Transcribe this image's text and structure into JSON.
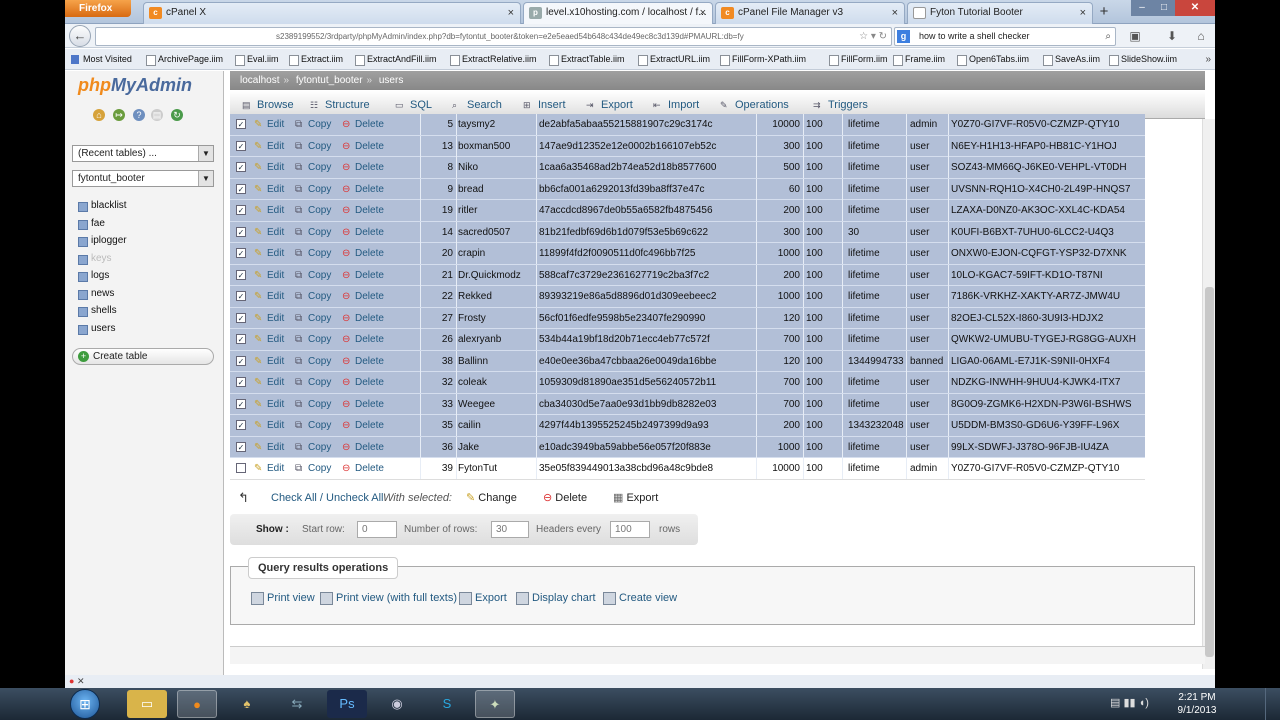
{
  "browser": {
    "app_button": "Firefox",
    "tabs": [
      {
        "title": "cPanel X",
        "icon": "cpanel-icon"
      },
      {
        "title": "level.x10hosting.com / localhost / f...",
        "icon": "pma-icon"
      },
      {
        "title": "cPanel File Manager v3",
        "icon": "cpanel-icon"
      },
      {
        "title": "Fyton Tutorial Booter",
        "icon": "page-icon"
      }
    ],
    "new_tab": "+",
    "url": "s2389199552/3rdparty/phpMyAdmin/index.php?db=fytontut_booter&token=e2e5eaed54b648c434de49ec8c3d139d#PMAURL:db=fy",
    "search_text": "how to write a shell checker",
    "bookmarks": [
      "Most Visited",
      "ArchivePage.iim",
      "Eval.iim",
      "Extract.iim",
      "ExtractAndFill.iim",
      "ExtractRelative.iim",
      "ExtractTable.iim",
      "ExtractURL.iim",
      "FillForm-XPath.iim",
      "FillForm.iim",
      "Frame.iim",
      "Open6Tabs.iim",
      "SaveAs.iim",
      "SlideShow.iim"
    ],
    "more": "»"
  },
  "pma": {
    "logo_php": "php",
    "logo_rest": "MyAdmin",
    "recent_tables": "(Recent tables) ...",
    "db_select": "fytontut_booter",
    "tables": [
      "blacklist",
      "fae",
      "iplogger",
      "keys",
      "logs",
      "news",
      "shells",
      "users"
    ],
    "create_table": "Create table",
    "breadcrumb": [
      "localhost",
      "fytontut_booter",
      "users"
    ],
    "menu": [
      "Browse",
      "Structure",
      "SQL",
      "Search",
      "Insert",
      "Export",
      "Import",
      "Operations",
      "Triggers"
    ],
    "actions": {
      "edit": "Edit",
      "copy": "Copy",
      "delete": "Delete"
    },
    "rows": [
      {
        "id": "5",
        "user": "taysmy2",
        "hash": "de2abfa5abaa55215881907c29c3174c",
        "c1": "10000",
        "c2": "100",
        "exp": "lifetime",
        "role": "admin",
        "key": "Y0Z70-GI7VF-R05V0-CZMZP-QTY10",
        "checked": true
      },
      {
        "id": "13",
        "user": "boxman500",
        "hash": "147ae9d12352e12e0002b166107eb52c",
        "c1": "300",
        "c2": "100",
        "exp": "lifetime",
        "role": "user",
        "key": "N6EY-H1H13-HFAP0-HB81C-Y1HOJ",
        "checked": true
      },
      {
        "id": "8",
        "user": "Niko",
        "hash": "1caa6a35468ad2b74ea52d18b8577600",
        "c1": "500",
        "c2": "100",
        "exp": "lifetime",
        "role": "user",
        "key": "SOZ43-MM66Q-J6KE0-VEHPL-VT0DH",
        "checked": true
      },
      {
        "id": "9",
        "user": "bread",
        "hash": "bb6cfa001a6292013fd39ba8ff37e47c",
        "c1": "60",
        "c2": "100",
        "exp": "lifetime",
        "role": "user",
        "key": "UVSNN-RQH1O-X4CH0-2L49P-HNQS7",
        "checked": true
      },
      {
        "id": "19",
        "user": "ritler",
        "hash": "47accdcd8967de0b55a6582fb4875456",
        "c1": "200",
        "c2": "100",
        "exp": "lifetime",
        "role": "user",
        "key": "LZAXA-D0NZ0-AK3OC-XXL4C-KDA54",
        "checked": true
      },
      {
        "id": "14",
        "user": "sacred0507",
        "hash": "81b21fedbf69d6b1d079f53e5b69c622",
        "c1": "300",
        "c2": "100",
        "exp": "30",
        "role": "user",
        "key": "K0UFI-B6BXT-7UHU0-6LCC2-U4Q3",
        "checked": true
      },
      {
        "id": "20",
        "user": "crapin",
        "hash": "11899f4fd2f0090511d0fc496bb7f25",
        "c1": "1000",
        "c2": "100",
        "exp": "lifetime",
        "role": "user",
        "key": "ONXW0-EJON-CQFGT-YSP32-D7XNK",
        "checked": true
      },
      {
        "id": "21",
        "user": "Dr.Quickmodz",
        "hash": "588caf7c3729e2361627719c2ba3f7c2",
        "c1": "200",
        "c2": "100",
        "exp": "lifetime",
        "role": "user",
        "key": "10LO-KGAC7-59IFT-KD1O-T87NI",
        "checked": true
      },
      {
        "id": "22",
        "user": "Rekked",
        "hash": "89393219e86a5d8896d01d309eebeec2",
        "c1": "1000",
        "c2": "100",
        "exp": "lifetime",
        "role": "user",
        "key": "7186K-VRKHZ-XAKTY-AR7Z-JMW4U",
        "checked": true
      },
      {
        "id": "27",
        "user": "Frosty",
        "hash": "56cf01f6edfe9598b5e23407fe290990",
        "c1": "120",
        "c2": "100",
        "exp": "lifetime",
        "role": "user",
        "key": "82OEJ-CL52X-I860-3U9I3-HDJX2",
        "checked": true
      },
      {
        "id": "26",
        "user": "alexryanb",
        "hash": "534b44a19bf18d20b71ecc4eb77c572f",
        "c1": "700",
        "c2": "100",
        "exp": "lifetime",
        "role": "user",
        "key": "QWKW2-UMUBU-TYGEJ-RG8GG-AUXH",
        "checked": true
      },
      {
        "id": "38",
        "user": "Ballinn",
        "hash": "e40e0ee36ba47cbbaa26e0049da16bbe",
        "c1": "120",
        "c2": "100",
        "exp": "1344994733",
        "role": "banned",
        "key": "LIGA0-06AML-E7J1K-S9NII-0HXF4",
        "checked": true
      },
      {
        "id": "32",
        "user": "coleak",
        "hash": "1059309d81890ae351d5e56240572b11",
        "c1": "700",
        "c2": "100",
        "exp": "lifetime",
        "role": "user",
        "key": "NDZKG-INWHH-9HUU4-KJWK4-ITX7",
        "checked": true
      },
      {
        "id": "33",
        "user": "Weegee",
        "hash": "cba34030d5e7aa0e93d1bb9db8282e03",
        "c1": "700",
        "c2": "100",
        "exp": "lifetime",
        "role": "user",
        "key": "8G0O9-ZGMK6-H2XDN-P3W6I-BSHWS",
        "checked": true
      },
      {
        "id": "35",
        "user": "cailin",
        "hash": "4297f44b1395525245b2497399d9a93",
        "c1": "200",
        "c2": "100",
        "exp": "1343232048",
        "role": "user",
        "key": "U5DDM-BM3S0-GD6U6-Y39FF-L96X",
        "checked": true
      },
      {
        "id": "36",
        "user": "Jake",
        "hash": "e10adc3949ba59abbe56e057f20f883e",
        "c1": "1000",
        "c2": "100",
        "exp": "lifetime",
        "role": "user",
        "key": "99LX-SDWFJ-J378O-96FJB-IU4ZA",
        "checked": true
      },
      {
        "id": "39",
        "user": "FytonTut",
        "hash": "35e05f839449013a38cbd96a48c9bde8",
        "c1": "10000",
        "c2": "100",
        "exp": "lifetime",
        "role": "admin",
        "key": "Y0Z70-GI7VF-R05V0-CZMZP-QTY10",
        "checked": false
      }
    ],
    "bulk": {
      "check_all": "Check All / Uncheck All",
      "with_selected": "With selected:",
      "change": "Change",
      "delete": "Delete",
      "export": "Export"
    },
    "show": {
      "label": "Show :",
      "start_row_label": "Start row:",
      "start_row": "0",
      "num_rows_label": "Number of rows:",
      "num_rows": "30",
      "headers_label": "Headers every",
      "headers": "100",
      "rows_suffix": "rows"
    },
    "qro": {
      "legend": "Query results operations",
      "items": [
        "Print view",
        "Print view (with full texts)",
        "Export",
        "Display chart",
        "Create view"
      ]
    }
  },
  "taskbar": {
    "time": "2:21 PM",
    "date": "9/1/2013"
  },
  "colors": {
    "selected_row": "#b2bfd7",
    "link": "#235a81",
    "firefox": "#e8791c"
  }
}
